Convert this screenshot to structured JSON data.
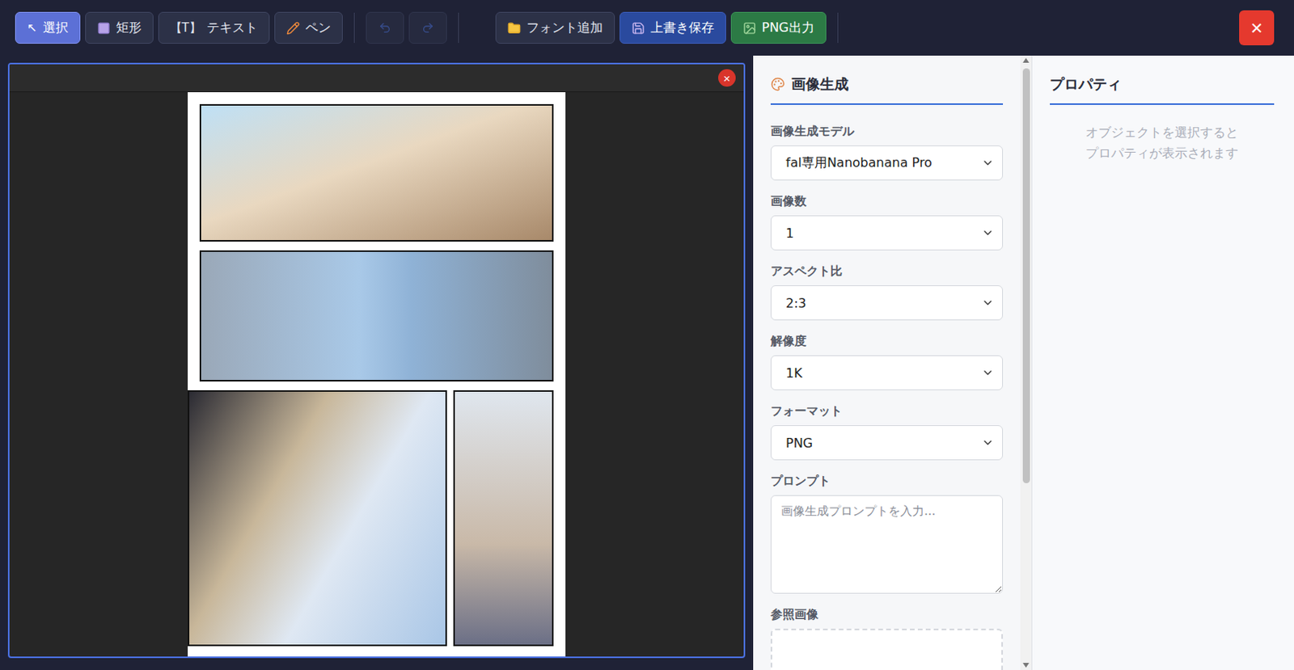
{
  "toolbar": {
    "tools": [
      {
        "kind": "select",
        "glyph": "↖",
        "label": "選択",
        "selected": true
      },
      {
        "kind": "rect",
        "label": "矩形",
        "selected": false
      },
      {
        "kind": "text",
        "glyph": "【T】",
        "label": "テキスト",
        "selected": false
      },
      {
        "kind": "pen",
        "label": "ペン",
        "selected": false
      }
    ],
    "history": [
      {
        "kind": "undo",
        "disabled": true
      },
      {
        "kind": "redo",
        "disabled": true
      }
    ],
    "actions": [
      {
        "kind": "font",
        "label": "フォント追加"
      },
      {
        "kind": "save",
        "label": "上書き保存"
      },
      {
        "kind": "export",
        "label": "PNG出力"
      }
    ],
    "close": "×"
  },
  "canvas": {
    "close": "×"
  },
  "generator": {
    "title": "画像生成",
    "fields": [
      {
        "kind": "select",
        "label": "画像生成モデル",
        "value": "fal専用Nanobanana Pro"
      },
      {
        "kind": "select",
        "label": "画像数",
        "value": "1"
      },
      {
        "kind": "select",
        "label": "アスペクト比",
        "value": "2:3"
      },
      {
        "kind": "select",
        "label": "解像度",
        "value": "1K"
      },
      {
        "kind": "select",
        "label": "フォーマット",
        "value": "PNG"
      },
      {
        "kind": "textarea",
        "label": "プロンプト",
        "placeholder": "画像生成プロンプトを入力..."
      },
      {
        "kind": "dropzone",
        "label": "参照画像"
      }
    ]
  },
  "properties": {
    "title": "プロパティ",
    "empty": [
      "オブジェクトを選択すると",
      "プロパティが表示されます"
    ]
  }
}
